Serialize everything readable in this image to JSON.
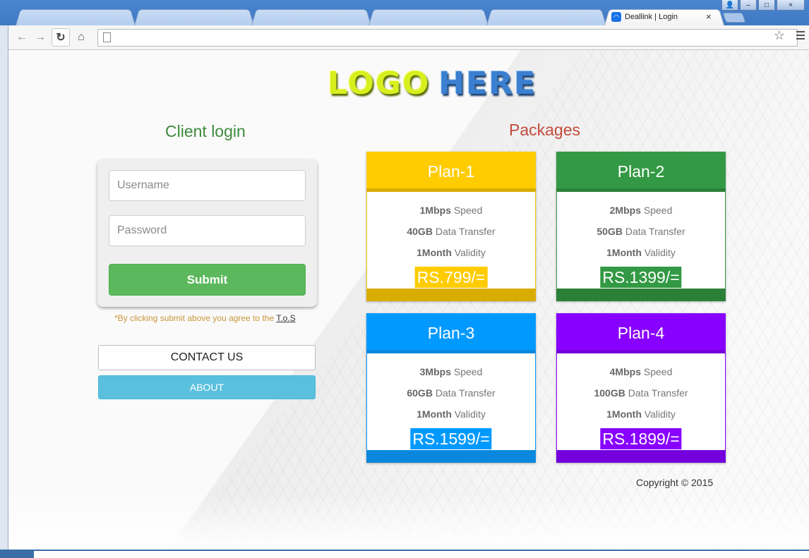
{
  "browser": {
    "active_tab_title": "Deallink | Login",
    "tab_close": "×",
    "window_controls": [
      "👤",
      "–",
      "□",
      "×"
    ]
  },
  "page": {
    "logo": {
      "word1": "LOGO",
      "word2": "HERE"
    },
    "client_login": {
      "title": "Client login",
      "username_placeholder": "Username",
      "password_placeholder": "Password",
      "submit_label": "Submit",
      "tos_text": "*By clicking submit above you agree to the ",
      "tos_link": "T.o.S"
    },
    "buttons": {
      "contact": "CONTACT US",
      "about": "ABOUT"
    },
    "packages": {
      "title": "Packages",
      "plans": [
        {
          "name": "Plan-1",
          "speed": "1Mbps",
          "data": "40GB",
          "validity": "1Month",
          "price": "RS.799/=",
          "color": "#ffcc00",
          "dark": "#d9ac00"
        },
        {
          "name": "Plan-2",
          "speed": "2Mbps",
          "data": "50GB",
          "validity": "1Month",
          "price": "RS.1399/=",
          "color": "#339944",
          "dark": "#2b8038"
        },
        {
          "name": "Plan-3",
          "speed": "3Mbps",
          "data": "60GB",
          "validity": "1Month",
          "price": "RS.1599/=",
          "color": "#0099ff",
          "dark": "#0a88dd"
        },
        {
          "name": "Plan-4",
          "speed": "4Mbps",
          "data": "100GB",
          "validity": "1Month",
          "price": "RS.1899/=",
          "color": "#8800ff",
          "dark": "#7300dd"
        }
      ],
      "speed_suffix": " Speed",
      "data_suffix": " Data Transfer",
      "validity_suffix": " Validity"
    },
    "copyright": "Copyright © 2015"
  }
}
